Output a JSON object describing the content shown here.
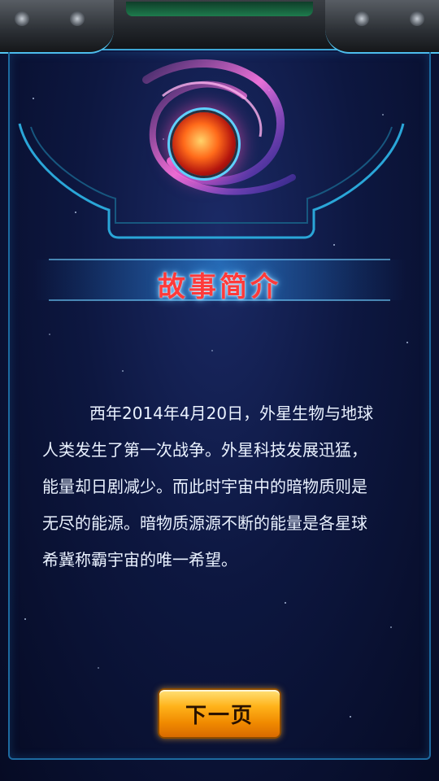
{
  "colors": {
    "background": "#0d1740",
    "frame_accent": "#52c3f0",
    "title_text": "#ff3a3a",
    "story_text": "#eaf2ff",
    "button_fill": "#ffb21a"
  },
  "header": {
    "orb_icon": "vortex-planet-icon"
  },
  "title": {
    "text": "故事简介"
  },
  "story": {
    "lines": [
      "西年2014年4月20日，外星生物与地球",
      "人类发生了第一次战争。外星科技发展迅猛，",
      "能量却日剧减少。而此时宇宙中的暗物质则是",
      "无尽的能源。暗物质源源不断的能量是各星球",
      "希冀称霸宇宙的唯一希望。"
    ]
  },
  "buttons": {
    "next_label": "下一页"
  }
}
